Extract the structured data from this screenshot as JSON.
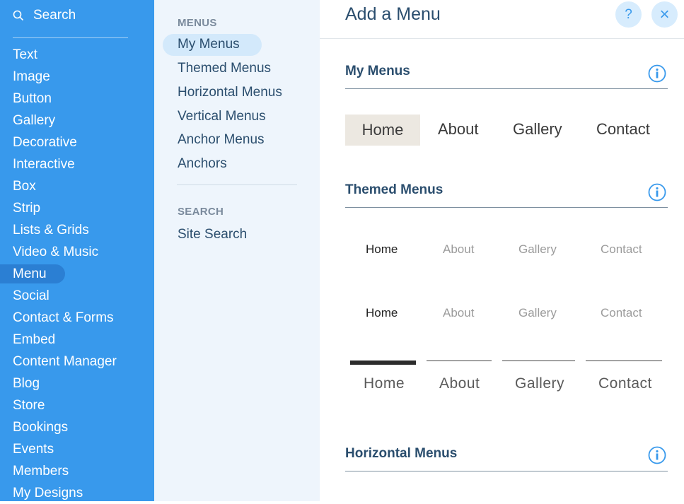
{
  "sidebar": {
    "search_label": "Search",
    "categories": [
      "Text",
      "Image",
      "Button",
      "Gallery",
      "Decorative",
      "Interactive",
      "Box",
      "Strip",
      "Lists & Grids",
      "Video & Music",
      "Menu",
      "Social",
      "Contact & Forms",
      "Embed",
      "Content Manager",
      "Blog",
      "Store",
      "Bookings",
      "Events",
      "Members",
      "My Designs"
    ],
    "selected": "Menu"
  },
  "subpanel": {
    "menus_heading": "MENUS",
    "items": [
      "My Menus",
      "Themed Menus",
      "Horizontal Menus",
      "Vertical Menus",
      "Anchor Menus",
      "Anchors"
    ],
    "active": "My Menus",
    "search_heading": "SEARCH",
    "search_items": [
      "Site Search"
    ]
  },
  "main": {
    "title": "Add a Menu",
    "help_icon": "?",
    "close_icon": "×",
    "sections": [
      {
        "title": "My Menus"
      },
      {
        "title": "Themed Menus"
      },
      {
        "title": "Horizontal Menus"
      }
    ],
    "my_menus_preview": [
      "Home",
      "About",
      "Gallery",
      "Contact"
    ],
    "themed_preview_1": [
      "Home",
      "About",
      "Gallery",
      "Contact"
    ],
    "themed_preview_2": [
      "Home",
      "About",
      "Gallery",
      "Contact"
    ],
    "themed_preview_3": [
      "Home",
      "About",
      "Gallery",
      "Contact"
    ]
  },
  "colors": {
    "sidebar_bg": "#3899ec",
    "sidebar_selected": "#2b7fd3",
    "subpanel_bg": "#eef5fc",
    "accent": "#3899ec",
    "title_text": "#2b4e6e",
    "selected_item_bg": "#ece8e1"
  }
}
